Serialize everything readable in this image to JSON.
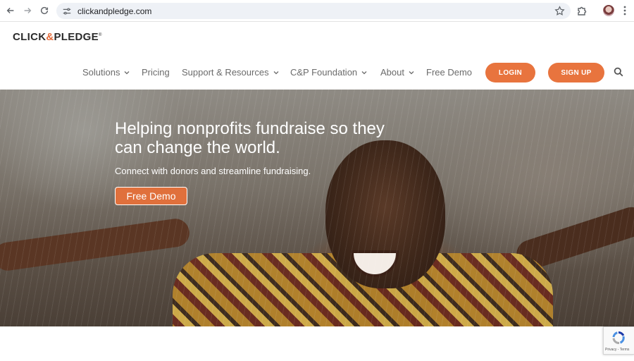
{
  "browser": {
    "url": "clickandpledge.com"
  },
  "site": {
    "logo": {
      "part1": "CLICK",
      "amp": "&",
      "part2": "PLEDGE",
      "reg": "®"
    },
    "nav": {
      "solutions": "Solutions",
      "pricing": "Pricing",
      "support": "Support & Resources",
      "foundation": "C&P Foundation",
      "about": "About",
      "free_demo": "Free Demo",
      "login": "LOGIN",
      "signup": "SIGN UP"
    },
    "accent_color": "#e8743e"
  },
  "hero": {
    "title": "Helping nonprofits fundraise so they can change the world.",
    "subtitle": "Connect with donors and streamline fundraising.",
    "cta": "Free Demo"
  },
  "recaptcha": {
    "terms": "Privacy - Terms"
  },
  "icons": {
    "back": "arrow-left-icon",
    "forward": "arrow-right-icon",
    "reload": "reload-icon",
    "site_settings": "tune-icon",
    "bookmark": "star-icon",
    "extensions": "puzzle-icon",
    "menu": "kebab-icon",
    "search": "search-icon"
  }
}
